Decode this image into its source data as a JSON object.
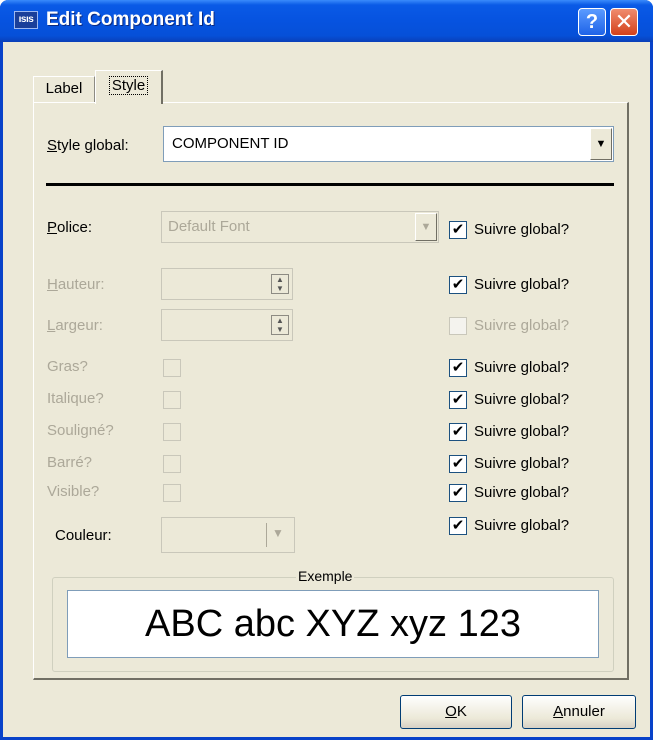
{
  "window": {
    "title": "Edit Component Id",
    "app_icon_text": "ısıs",
    "help_label": "?",
    "close_label": "✕"
  },
  "tabs": [
    {
      "label": "Label",
      "active": false
    },
    {
      "label": "Style",
      "active": true
    }
  ],
  "style_global": {
    "label": "Style global:",
    "value": "COMPONENT ID"
  },
  "police": {
    "label": "Police:",
    "value": "Default Font",
    "follow_label": "Suivre global?",
    "follow_checked": true
  },
  "hauteur": {
    "label": "Hauteur:",
    "follow_label": "Suivre global?",
    "follow_checked": true
  },
  "largeur": {
    "label": "Largeur:",
    "follow_label": "Suivre global?",
    "follow_checked": false,
    "follow_disabled": true
  },
  "flags": [
    {
      "label": "Gras?",
      "follow_label": "Suivre global?",
      "follow_checked": true
    },
    {
      "label": "Italique?",
      "follow_label": "Suivre global?",
      "follow_checked": true
    },
    {
      "label": "Souligné?",
      "follow_label": "Suivre global?",
      "follow_checked": true
    },
    {
      "label": "Barré?",
      "follow_label": "Suivre global?",
      "follow_checked": true
    },
    {
      "label": "Visible?",
      "follow_label": "Suivre global?",
      "follow_checked": true
    }
  ],
  "couleur": {
    "label": "Couleur:",
    "follow_label": "Suivre global?",
    "follow_checked": true
  },
  "example": {
    "legend": "Exemple",
    "text": "ABC abc XYZ xyz 123"
  },
  "buttons": {
    "ok": "OK",
    "cancel": "Annuler"
  },
  "colors": {
    "title_bar": "#0653e0",
    "dialog_bg": "#ece9d8",
    "disabled_text": "#aca899"
  }
}
